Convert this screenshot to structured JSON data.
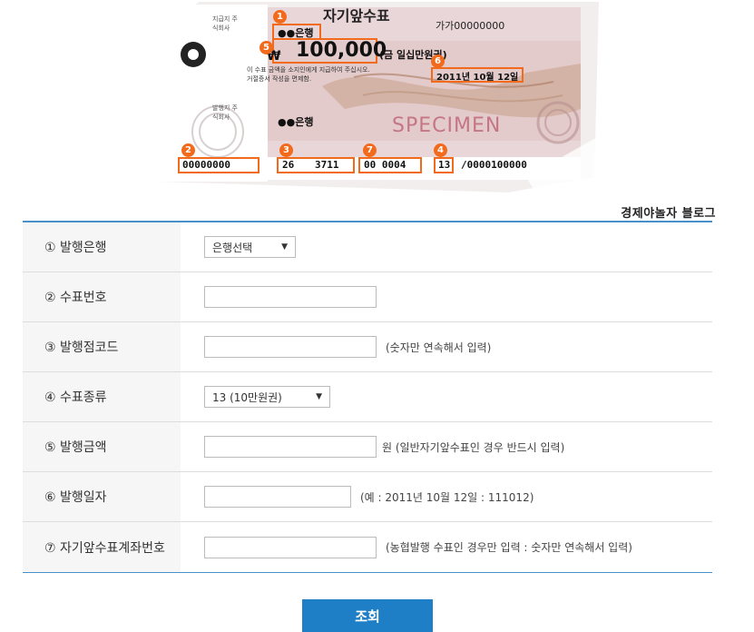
{
  "check": {
    "bank_name": "●●은행",
    "title": "자기앞수표",
    "serial": "가가00000000",
    "amount": "100,000",
    "amount_text": "(금 일십만원권)",
    "issue_date": "2011년 10월 12일",
    "account_no": "00000000",
    "branch_code": "26",
    "micr_middle": "3711",
    "micr_right": "00 0004",
    "type_code": "13",
    "micr_end": "/0000100000",
    "specimen": "SPECIMEN",
    "issuer_label": "지급지 주식회사",
    "payer_label": "발행지 주식회사",
    "notice_line1": "이 수표 금액을 소지인에게 지급하여 주십시오.",
    "notice_line2": "거절증서 작성을 면제함.",
    "bottom_bank": "●●은행",
    "marker_colors": "#f26a1b",
    "markers": [
      "1",
      "2",
      "3",
      "4",
      "5",
      "6",
      "7"
    ]
  },
  "blog_label": "경제야놀자 블로그",
  "form": {
    "rows": [
      {
        "label": "① 발행은행",
        "type": "select",
        "value": "은행선택",
        "hint": ""
      },
      {
        "label": "② 수표번호",
        "type": "input",
        "value": "",
        "hint": ""
      },
      {
        "label": "③ 발행점코드",
        "type": "input",
        "value": "",
        "hint": "(숫자만 연속해서 입력)"
      },
      {
        "label": "④ 수표종류",
        "type": "select",
        "value": "13 (10만원권)",
        "hint": ""
      },
      {
        "label": "⑤ 발행금액",
        "type": "input",
        "value": "",
        "hint": "원  (일반자기앞수표인 경우 반드시 입력)"
      },
      {
        "label": "⑥ 발행일자",
        "type": "input",
        "value": "",
        "hint": "(예 : 2011년 10월 12일 : 111012)"
      },
      {
        "label": "⑦ 자기앞수표계좌번호",
        "type": "input",
        "value": "",
        "hint": "(농협발행 수표인 경우만 입력 : 숫자만 연속해서 입력)"
      }
    ]
  },
  "submit_label": "조회",
  "colors": {
    "accent": "#1e7fc6",
    "table_border": "#4a90c8",
    "marker": "#f26a1b"
  }
}
